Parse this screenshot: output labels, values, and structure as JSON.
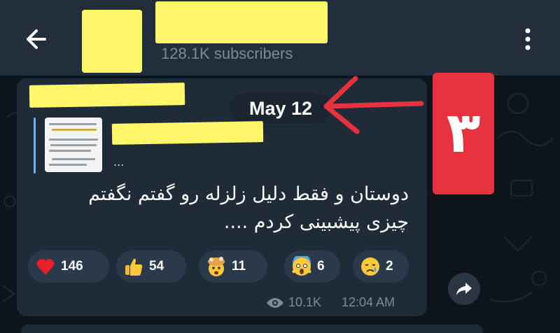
{
  "header": {
    "subscribers": "128.1K subscribers"
  },
  "message": {
    "date": "May 12",
    "quote_ellipsis": "...",
    "text": "دوستان و فقط دلیل زلزله رو گفتم نگفتم چیزی پیشبینی کردم ....",
    "reactions": [
      {
        "emoji": "heart-icon",
        "count": "146"
      },
      {
        "emoji": "thumbs-up-icon",
        "count": "54"
      },
      {
        "emoji": "exploding-head-icon",
        "count": "11"
      },
      {
        "emoji": "screaming-face-icon",
        "count": "6"
      },
      {
        "emoji": "crying-face-icon",
        "count": "2"
      }
    ],
    "views": "10.1K",
    "time": "12:04 AM"
  },
  "annotation": {
    "digit": "۳"
  },
  "colors": {
    "header_bg": "#232e3c",
    "bubble_bg": "#1f2b36",
    "reaction_bg": "#2a3a4a",
    "redaction": "#fff66a",
    "annotation_red": "#e8323f",
    "secondary_text": "#7f8a97"
  }
}
